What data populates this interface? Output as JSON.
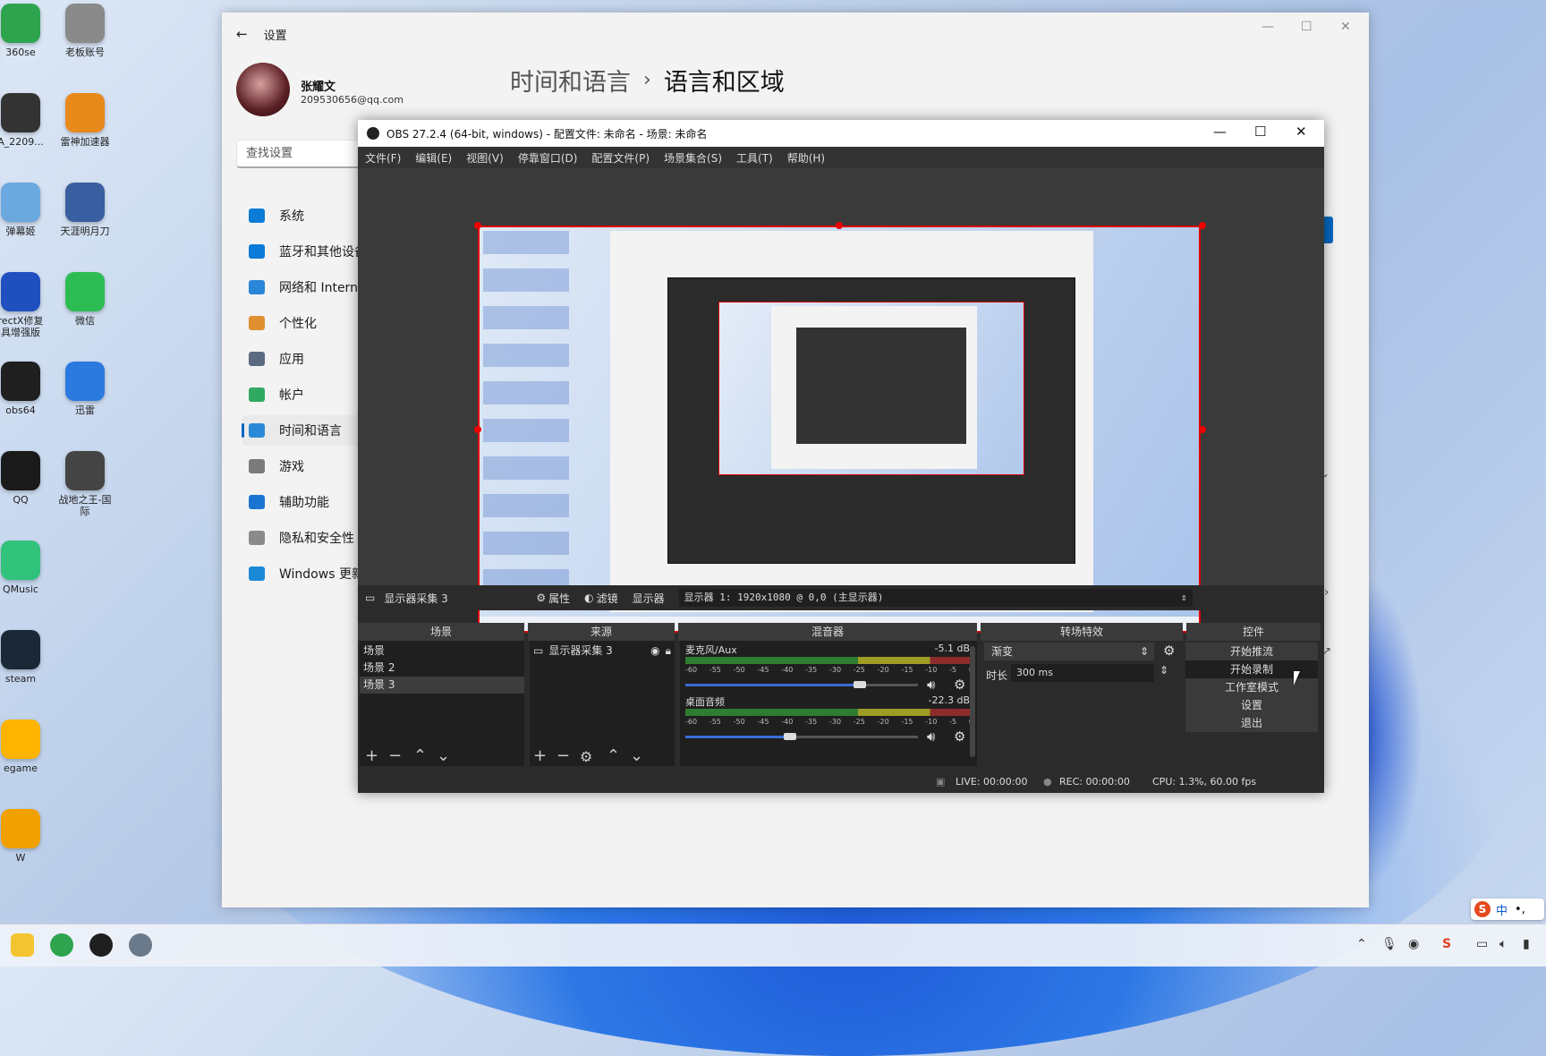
{
  "desktop": {
    "icons": [
      {
        "label": "360se",
        "color": "#2ea44f"
      },
      {
        "label": "老板账号",
        "color": "#8a8a8a"
      },
      {
        "label": "A_2209...",
        "color": "#333"
      },
      {
        "label": "雷神加速器",
        "color": "#e8891c"
      },
      {
        "label": "弹幕姬",
        "color": "#6aa8e0"
      },
      {
        "label": "天涯明月刀",
        "color": "#3a5fa0"
      },
      {
        "label": "rectX修复\n具增强版",
        "color": "#2050c0"
      },
      {
        "label": "微信",
        "color": "#2dbc53"
      },
      {
        "label": "obs64",
        "color": "#1f1f1f"
      },
      {
        "label": "迅雷",
        "color": "#2b7ae0"
      },
      {
        "label": "QQ",
        "color": "#1a1a1a"
      },
      {
        "label": "战地之王-国\n际",
        "color": "#444"
      },
      {
        "label": "QMusic",
        "color": "#31c27c"
      },
      {
        "label": "steam",
        "color": "#1b2838"
      },
      {
        "label": "egame",
        "color": "#ffb400"
      },
      {
        "label": "W",
        "color": "#f0a000"
      }
    ]
  },
  "settings": {
    "title": "设置",
    "user_name": "张耀文",
    "user_email": "209530656@qq.com",
    "search_placeholder": "查找设置",
    "breadcrumb_parent": "时间和语言",
    "breadcrumb_sep": "›",
    "breadcrumb_current": "语言和区域",
    "sidebar": [
      {
        "label": "系统",
        "color": "#0a7bd6"
      },
      {
        "label": "蓝牙和其他设备",
        "color": "#0a7bd6"
      },
      {
        "label": "网络和 Internet",
        "color": "#2a86d8"
      },
      {
        "label": "个性化",
        "color": "#e09030"
      },
      {
        "label": "应用",
        "color": "#5a6a80"
      },
      {
        "label": "帐户",
        "color": "#2faa60"
      },
      {
        "label": "时间和语言",
        "color": "#2a8ad8"
      },
      {
        "label": "游戏",
        "color": "#7a7a7a"
      },
      {
        "label": "辅助功能",
        "color": "#1a76d0"
      },
      {
        "label": "隐私和安全性",
        "color": "#8a8a8a"
      },
      {
        "label": "Windows 更新",
        "color": "#1a8ad8"
      }
    ]
  },
  "obs": {
    "title": "OBS 27.2.4 (64-bit, windows) - 配置文件: 未命名 - 场景: 未命名",
    "menu": [
      "文件(F)",
      "编辑(E)",
      "视图(V)",
      "停靠窗口(D)",
      "配置文件(P)",
      "场景集合(S)",
      "工具(T)",
      "帮助(H)"
    ],
    "source_name": "显示器采集 3",
    "props_label": "属性",
    "filters_label": "滤镜",
    "display_label": "显示器",
    "display_value": "显示器 1: 1920x1080 @ 0,0 (主显示器)",
    "docks": {
      "scenes": "场景",
      "sources": "来源",
      "mixer": "混音器",
      "transitions": "转场特效",
      "controls": "控件"
    },
    "scenes": [
      "场景",
      "场景 2",
      "场景 3"
    ],
    "sources": [
      "显示器采集 3"
    ],
    "mixer": [
      {
        "name": "麦克风/Aux",
        "db": "-5.1 dB",
        "level": 0.75
      },
      {
        "name": "桌面音频",
        "db": "-22.3 dB",
        "level": 0.45
      }
    ],
    "scale_ticks": [
      "-60",
      "-55",
      "-50",
      "-45",
      "-40",
      "-35",
      "-30",
      "-25",
      "-20",
      "-15",
      "-10",
      "-5",
      "0"
    ],
    "transition": "渐变",
    "duration_label": "时长",
    "duration_value": "300 ms",
    "controls": [
      "开始推流",
      "开始录制",
      "工作室模式",
      "设置",
      "退出"
    ],
    "status": {
      "live": "LIVE: 00:00:00",
      "rec": "REC: 00:00:00",
      "cpu": "CPU: 1.3%, 60.00 fps"
    }
  },
  "taskbar": {
    "ime": "中"
  }
}
